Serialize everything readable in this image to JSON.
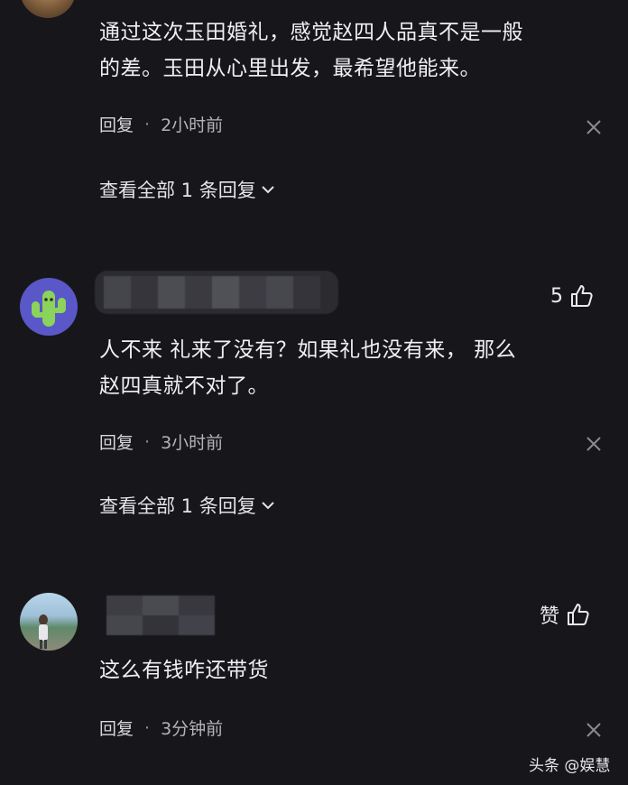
{
  "comments": [
    {
      "text_line1": "通过这次玉田婚礼，感觉赵四人品真不是一般",
      "text_line2": "的差。玉田从心里出发，最希望他能来。",
      "reply_label": "回复",
      "separator": "·",
      "time": "2小时前",
      "view_replies": "查看全部 1 条回复"
    },
    {
      "like_count": "5",
      "text_line1": "人不来 礼来了没有？如果礼也没有来， 那么",
      "text_line2": "赵四真就不对了。",
      "reply_label": "回复",
      "separator": "·",
      "time": "3小时前",
      "view_replies": "查看全部 1 条回复"
    },
    {
      "like_label": "赞",
      "text_line1": "这么有钱咋还带货",
      "reply_label": "回复",
      "separator": "·",
      "time": "3分钟前"
    }
  ],
  "watermark": "头条 @娱慧",
  "colors": {
    "background": "#17171b",
    "text": "#ececf0",
    "muted": "#b4b4b8",
    "cactus_avatar_bg": "#5a57c9",
    "cactus_green": "#8bd35a"
  },
  "icons": [
    "close-icon",
    "chevron-down-icon",
    "thumbs-up-icon",
    "cactus-avatar",
    "photo-avatar"
  ]
}
